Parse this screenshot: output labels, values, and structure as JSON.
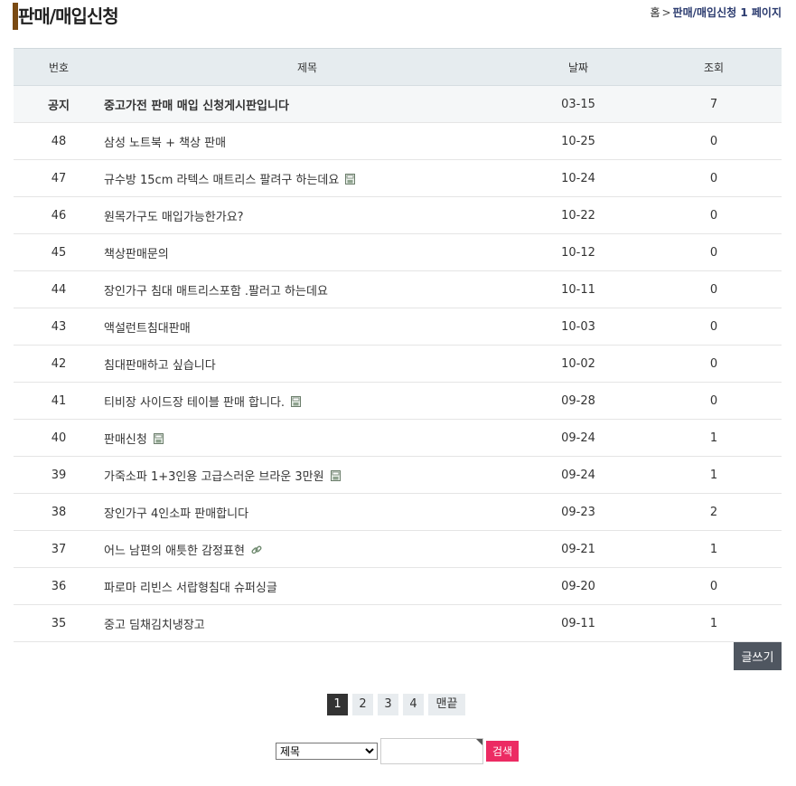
{
  "page": {
    "title": "판매/매입신청",
    "breadcrumb": {
      "home": "홈",
      "sep": ">",
      "current": "판매/매입신청 1 페이지"
    }
  },
  "table": {
    "headers": {
      "num": "번호",
      "subject": "제목",
      "date": "날짜",
      "hits": "조회"
    },
    "notice": {
      "num": "공지",
      "subject": "중고가전 판매 매입 신청게시판입니다",
      "date": "03-15",
      "hits": "7"
    },
    "rows": [
      {
        "num": "48",
        "subject": "삼성 노트북 + 책상 판매",
        "date": "10-25",
        "hits": "0",
        "icon": ""
      },
      {
        "num": "47",
        "subject": "규수방 15cm 라텍스 매트리스 팔려구 하는데요",
        "date": "10-24",
        "hits": "0",
        "icon": "file-icon"
      },
      {
        "num": "46",
        "subject": "원목가구도 매입가능한가요?",
        "date": "10-22",
        "hits": "0",
        "icon": ""
      },
      {
        "num": "45",
        "subject": "책상판매문의",
        "date": "10-12",
        "hits": "0",
        "icon": ""
      },
      {
        "num": "44",
        "subject": "장인가구 침대 매트리스포함 .팔러고 하는데요",
        "date": "10-11",
        "hits": "0",
        "icon": ""
      },
      {
        "num": "43",
        "subject": "액설런트침대판매",
        "date": "10-03",
        "hits": "0",
        "icon": ""
      },
      {
        "num": "42",
        "subject": "침대판매하고 싶습니다",
        "date": "10-02",
        "hits": "0",
        "icon": ""
      },
      {
        "num": "41",
        "subject": "티비장 사이드장 테이블 판매 합니다.",
        "date": "09-28",
        "hits": "0",
        "icon": "file-icon"
      },
      {
        "num": "40",
        "subject": "판매신청",
        "date": "09-24",
        "hits": "1",
        "icon": "file-icon"
      },
      {
        "num": "39",
        "subject": "가죽소파 1+3인용 고급스러운 브라운 3만원",
        "date": "09-24",
        "hits": "1",
        "icon": "file-icon"
      },
      {
        "num": "38",
        "subject": "장인가구 4인소파 판매합니다",
        "date": "09-23",
        "hits": "2",
        "icon": ""
      },
      {
        "num": "37",
        "subject": "어느 남편의 애틋한 감정표현",
        "date": "09-21",
        "hits": "1",
        "icon": "link-icon"
      },
      {
        "num": "36",
        "subject": "파로마 리빈스 서랍형침대 슈퍼싱글",
        "date": "09-20",
        "hits": "0",
        "icon": ""
      },
      {
        "num": "35",
        "subject": "중고 딤채김치냉장고",
        "date": "09-11",
        "hits": "1",
        "icon": ""
      }
    ]
  },
  "actions": {
    "write_label": "글쓰기"
  },
  "pagination": {
    "pages": [
      "1",
      "2",
      "3",
      "4"
    ],
    "active": "1",
    "last_label": "맨끝"
  },
  "search": {
    "selected_option": "제목",
    "input_value": "",
    "button_label": "검색"
  },
  "colors": {
    "title_accent": "#7a4a12",
    "search_button": "#ec2b63",
    "write_button": "#4f5660",
    "header_bg": "#e6ecef"
  }
}
